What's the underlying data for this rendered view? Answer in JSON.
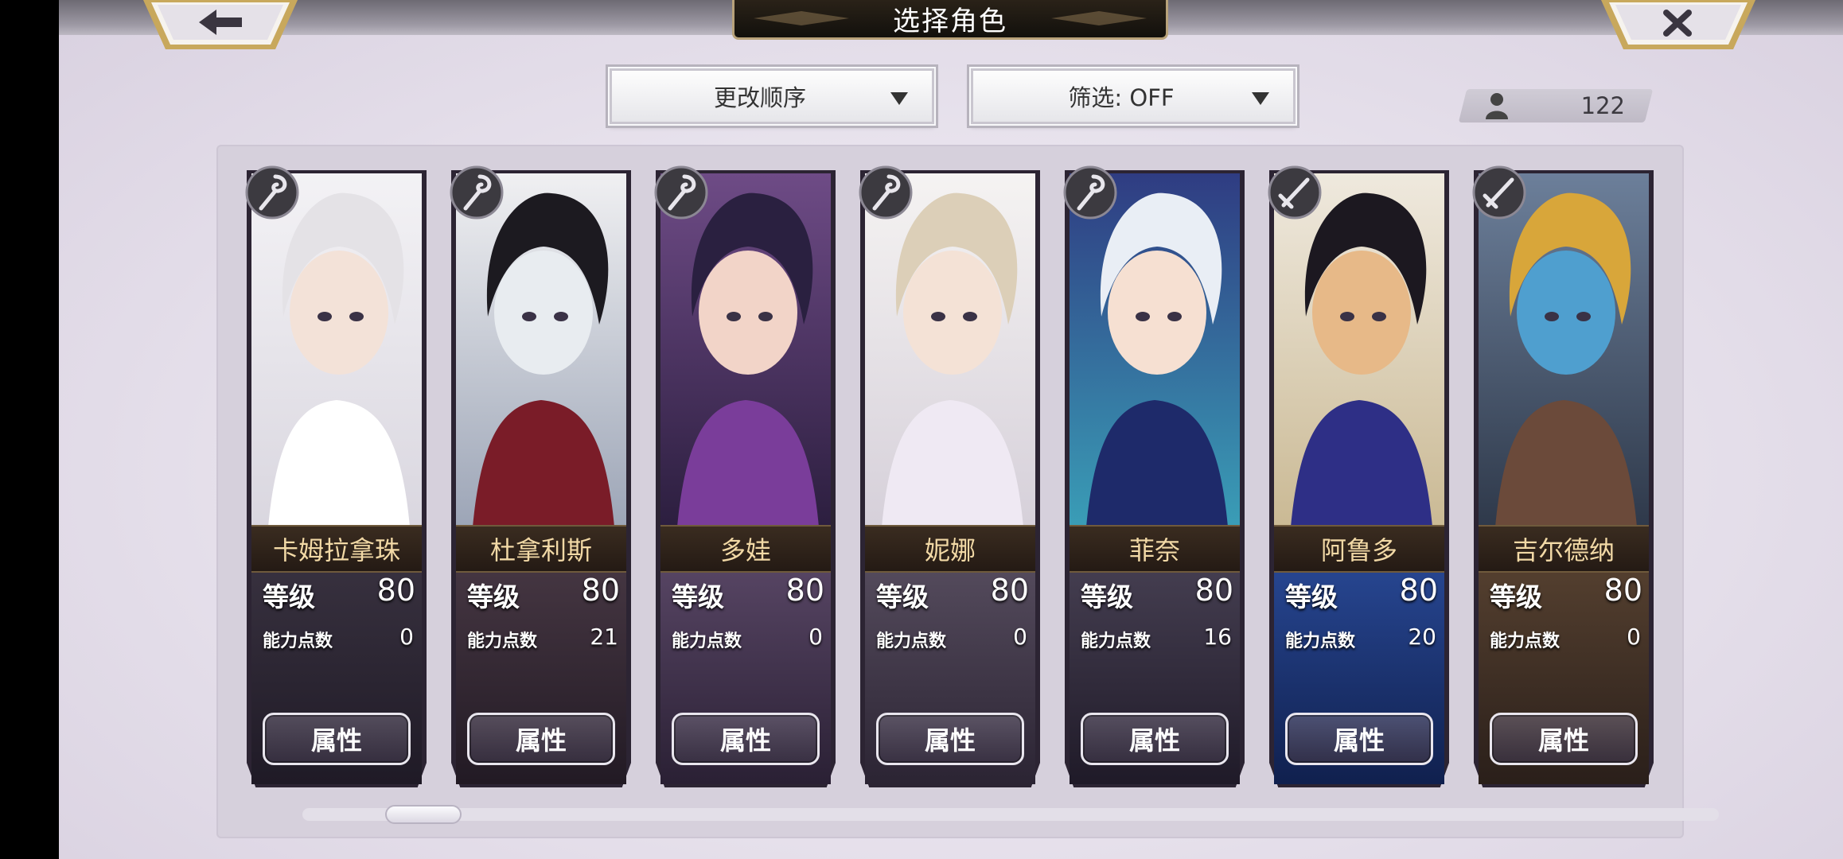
{
  "header": {
    "title": "选择角色"
  },
  "controls": {
    "sort_label": "更改顺序",
    "filter_label": "筛选: OFF",
    "roster_count": "122"
  },
  "cards": [
    {
      "name": "卡姆拉拿珠",
      "level_label": "等级",
      "level": "80",
      "ap_label": "能力点数",
      "ap": "0",
      "button": "属性",
      "class_icon": "staff-icon"
    },
    {
      "name": "杜拿利斯",
      "level_label": "等级",
      "level": "80",
      "ap_label": "能力点数",
      "ap": "21",
      "button": "属性",
      "class_icon": "staff-icon"
    },
    {
      "name": "多娃",
      "level_label": "等级",
      "level": "80",
      "ap_label": "能力点数",
      "ap": "0",
      "button": "属性",
      "class_icon": "staff-icon"
    },
    {
      "name": "妮娜",
      "level_label": "等级",
      "level": "80",
      "ap_label": "能力点数",
      "ap": "0",
      "button": "属性",
      "class_icon": "staff-icon"
    },
    {
      "name": "菲奈",
      "level_label": "等级",
      "level": "80",
      "ap_label": "能力点数",
      "ap": "16",
      "button": "属性",
      "class_icon": "staff-icon"
    },
    {
      "name": "阿鲁多",
      "level_label": "等级",
      "level": "80",
      "ap_label": "能力点数",
      "ap": "20",
      "button": "属性",
      "class_icon": "sword-icon"
    },
    {
      "name": "吉尔德纳",
      "level_label": "等级",
      "level": "80",
      "ap_label": "能力点数",
      "ap": "0",
      "button": "属性",
      "class_icon": "sword-icon"
    }
  ],
  "colors": {
    "name_text": "#f2d9a6",
    "frame": "#2c2433",
    "title_border": "#b8a27a"
  }
}
